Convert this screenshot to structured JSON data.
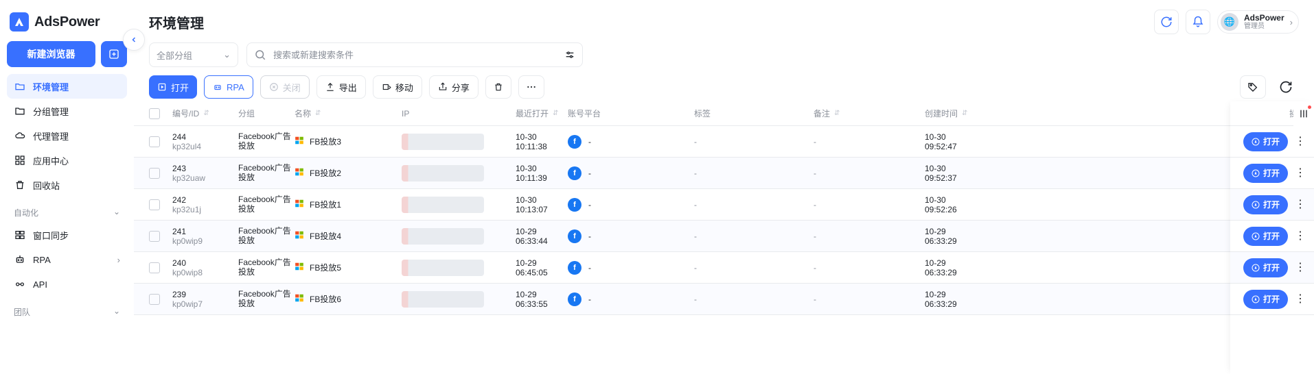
{
  "app": {
    "name": "AdsPower",
    "title": "环境管理",
    "user_name": "AdsPower",
    "user_role": "管理员"
  },
  "sidebar": {
    "new_browser_label": "新建浏览器",
    "section_auto_label": "自动化",
    "section_team_label": "团队",
    "items": [
      {
        "label": "环境管理",
        "icon": "folder-open-icon",
        "active": true
      },
      {
        "label": "分组管理",
        "icon": "folder-icon"
      },
      {
        "label": "代理管理",
        "icon": "cloud-icon"
      },
      {
        "label": "应用中心",
        "icon": "grid-icon"
      },
      {
        "label": "回收站",
        "icon": "trash-icon"
      }
    ],
    "auto_items": [
      {
        "label": "窗口同步",
        "icon": "sync-icon"
      },
      {
        "label": "RPA",
        "icon": "robot-icon",
        "expandable": true
      },
      {
        "label": "API",
        "icon": "api-icon"
      }
    ]
  },
  "toolbar": {
    "group_select_label": "全部分组",
    "search_placeholder": "搜索或新建搜索条件",
    "open_label": "打开",
    "rpa_label": "RPA",
    "close_label": "关闭",
    "export_label": "导出",
    "move_label": "移动",
    "share_label": "分享"
  },
  "columns": {
    "id": "编号/ID",
    "group": "分组",
    "name": "名称",
    "ip": "IP",
    "last": "最近打开",
    "platform": "账号平台",
    "tag": "标签",
    "note": "备注",
    "created": "创建时间",
    "action": "操作"
  },
  "row_open_label": "打开",
  "rows": [
    {
      "no": "244",
      "id": "kp32ul4",
      "group": "Facebook广告投放",
      "name": "FB投放3",
      "last_line1": "10-30",
      "last_line2": "10:11:38",
      "plat": "-",
      "tag": "-",
      "note": "-",
      "ct_line1": "10-30",
      "ct_line2": "09:52:47"
    },
    {
      "no": "243",
      "id": "kp32uaw",
      "group": "Facebook广告投放",
      "name": "FB投放2",
      "last_line1": "10-30",
      "last_line2": "10:11:39",
      "plat": "-",
      "tag": "-",
      "note": "-",
      "ct_line1": "10-30",
      "ct_line2": "09:52:37"
    },
    {
      "no": "242",
      "id": "kp32u1j",
      "group": "Facebook广告投放",
      "name": "FB投放1",
      "last_line1": "10-30",
      "last_line2": "10:13:07",
      "plat": "-",
      "tag": "-",
      "note": "-",
      "ct_line1": "10-30",
      "ct_line2": "09:52:26"
    },
    {
      "no": "241",
      "id": "kp0wip9",
      "group": "Facebook广告投放",
      "name": "FB投放4",
      "last_line1": "10-29",
      "last_line2": "06:33:44",
      "plat": "-",
      "tag": "-",
      "note": "-",
      "ct_line1": "10-29",
      "ct_line2": "06:33:29"
    },
    {
      "no": "240",
      "id": "kp0wip8",
      "group": "Facebook广告投放",
      "name": "FB投放5",
      "last_line1": "10-29",
      "last_line2": "06:45:05",
      "plat": "-",
      "tag": "-",
      "note": "-",
      "ct_line1": "10-29",
      "ct_line2": "06:33:29"
    },
    {
      "no": "239",
      "id": "kp0wip7",
      "group": "Facebook广告投放",
      "name": "FB投放6",
      "last_line1": "10-29",
      "last_line2": "06:33:55",
      "plat": "-",
      "tag": "-",
      "note": "-",
      "ct_line1": "10-29",
      "ct_line2": "06:33:29"
    }
  ]
}
